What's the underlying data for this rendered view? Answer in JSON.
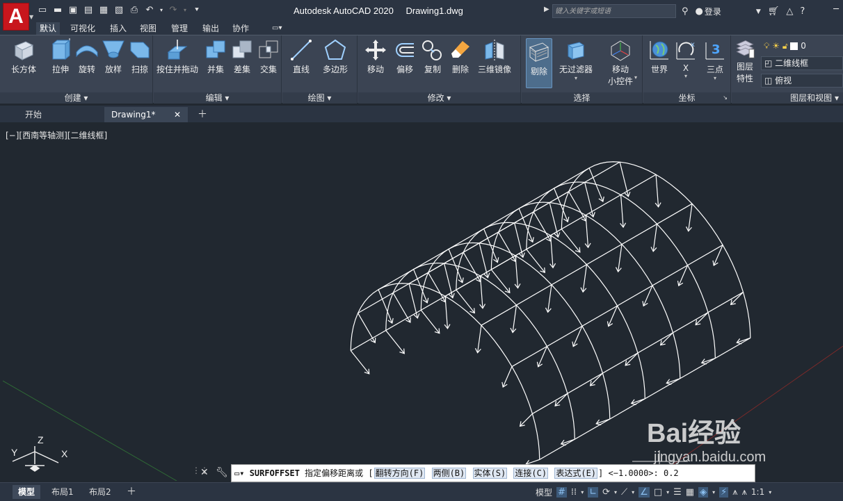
{
  "app": {
    "logo": "A",
    "title": "Autodesk AutoCAD 2020",
    "document": "Drawing1.dwg"
  },
  "search": {
    "placeholder": "键入关键字或短语"
  },
  "account": {
    "login": "登录"
  },
  "ribbon_tabs": [
    {
      "label": "默认"
    },
    {
      "label": "可视化"
    },
    {
      "label": "插入"
    },
    {
      "label": "视图"
    },
    {
      "label": "管理"
    },
    {
      "label": "输出"
    },
    {
      "label": "协作"
    }
  ],
  "panels": {
    "create": {
      "title": "创建",
      "tools": [
        {
          "label": "长方体"
        },
        {
          "label": "拉伸"
        },
        {
          "label": "旋转"
        },
        {
          "label": "放样"
        },
        {
          "label": "扫掠"
        }
      ]
    },
    "edit": {
      "title": "编辑",
      "tools": [
        {
          "label": "按住并拖动"
        },
        {
          "label": "并集"
        },
        {
          "label": "差集"
        },
        {
          "label": "交集"
        }
      ]
    },
    "draw": {
      "title": "绘图",
      "tools": [
        {
          "label": "直线"
        },
        {
          "label": "多边形"
        }
      ]
    },
    "modify": {
      "title": "修改",
      "tools": [
        {
          "label": "移动"
        },
        {
          "label": "偏移"
        },
        {
          "label": "复制"
        },
        {
          "label": "删除"
        },
        {
          "label": "三维镜像"
        }
      ]
    },
    "selection": {
      "title": "选择",
      "tools": [
        {
          "label": "剔除"
        },
        {
          "label": "无过滤器"
        },
        {
          "label": "移动"
        },
        {
          "label": "小控件"
        }
      ]
    },
    "coords": {
      "title": "坐标",
      "tools": [
        {
          "label": "世界"
        },
        {
          "label": "X"
        },
        {
          "label": "三点"
        }
      ]
    },
    "layers": {
      "title": "图层和视图",
      "layer_tool": "图层",
      "layer_tool2": "特性",
      "layer_value": "0",
      "visual_style": "二维线框",
      "view": "俯视"
    }
  },
  "file_tabs": [
    {
      "label": "开始"
    },
    {
      "label": "Drawing1*"
    }
  ],
  "viewport": {
    "label": "[−][西南等轴测][二维线框]"
  },
  "ucs": {
    "x": "X",
    "y": "Y",
    "z": "Z"
  },
  "command": {
    "name": "SURFOFFSET",
    "prompt": "指定偏移距离或",
    "options": [
      "翻转方向(F)",
      "两侧(B)",
      "实体(S)",
      "连接(C)",
      "表达式(E)"
    ],
    "default": "<−1.0000>:",
    "input": "0.2"
  },
  "layout_tabs": [
    {
      "label": "模型"
    },
    {
      "label": "布局1"
    },
    {
      "label": "布局2"
    }
  ],
  "status": {
    "mode": "模型",
    "scale": "1:1"
  },
  "watermark": {
    "text": "Bai经验",
    "url": "jingyan.baidu.com"
  }
}
